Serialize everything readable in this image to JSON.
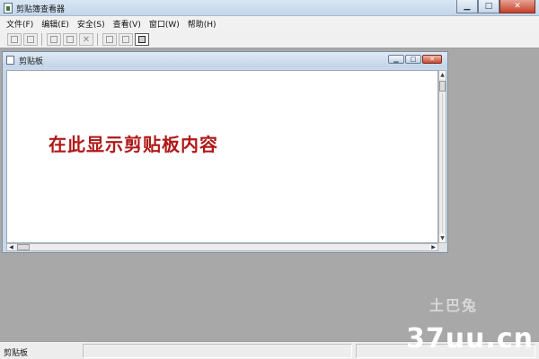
{
  "window": {
    "title": "剪贴簿查看器",
    "controls": {
      "minimize_icon": "minimize-icon",
      "maximize_icon": "maximize-icon",
      "close_icon": "close-icon"
    }
  },
  "menu": {
    "items": [
      "文件(F)",
      "编辑(E)",
      "安全(S)",
      "查看(V)",
      "窗口(W)",
      "帮助(H)"
    ]
  },
  "toolbar": {
    "buttons": [
      "open-icon",
      "save-icon",
      "copy-icon",
      "paste-icon",
      "delete-icon",
      "tile-horizontal-icon",
      "tile-vertical-icon",
      "clipboard-view-icon"
    ]
  },
  "child_window": {
    "title": "剪贴板",
    "content_text": "在此显示剪贴板内容"
  },
  "status": {
    "text": "剪贴板"
  },
  "watermark": {
    "text": "37uu.cn",
    "logo_text": "土巴兔"
  }
}
